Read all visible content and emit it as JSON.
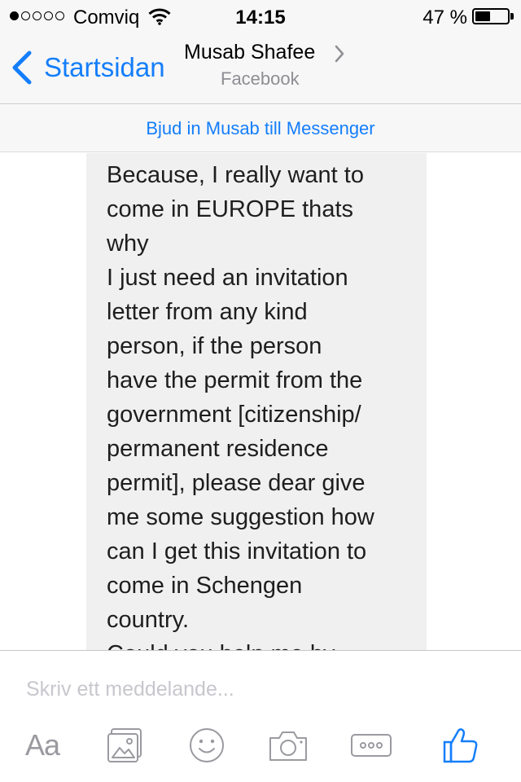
{
  "status_bar": {
    "carrier": "Comviq",
    "time": "14:15",
    "battery_percent": "47 %",
    "battery_level": 0.47,
    "signal_strength": 1
  },
  "nav": {
    "back_label": "Startsidan",
    "contact_name": "Musab Shafee",
    "contact_subtitle": "Facebook"
  },
  "invite_banner": {
    "text": "Bjud in Musab till Messenger"
  },
  "message": {
    "lines": [
      "Because, I really want to",
      "come in EUROPE thats",
      "why",
      "I just need an invitation",
      "letter from any kind",
      "person, if the person",
      "have the permit from the",
      "government [citizenship/",
      "permanent residence",
      "permit], please dear give",
      "me some suggestion how",
      "can I get this invitation to",
      "come in Schengen",
      "country.",
      "Could you help me by"
    ]
  },
  "composer": {
    "placeholder": "Skriv ett meddelande...",
    "text_format_label": "Aa"
  },
  "icons": {
    "text-format": "text-format-icon",
    "photo": "photo-icon",
    "emoji": "emoji-icon",
    "camera": "camera-icon",
    "more": "more-icon",
    "like": "like-icon"
  },
  "colors": {
    "accent": "#147efb",
    "bubble": "#f0f0f0",
    "toolbar_icon": "#9a9aa0"
  }
}
